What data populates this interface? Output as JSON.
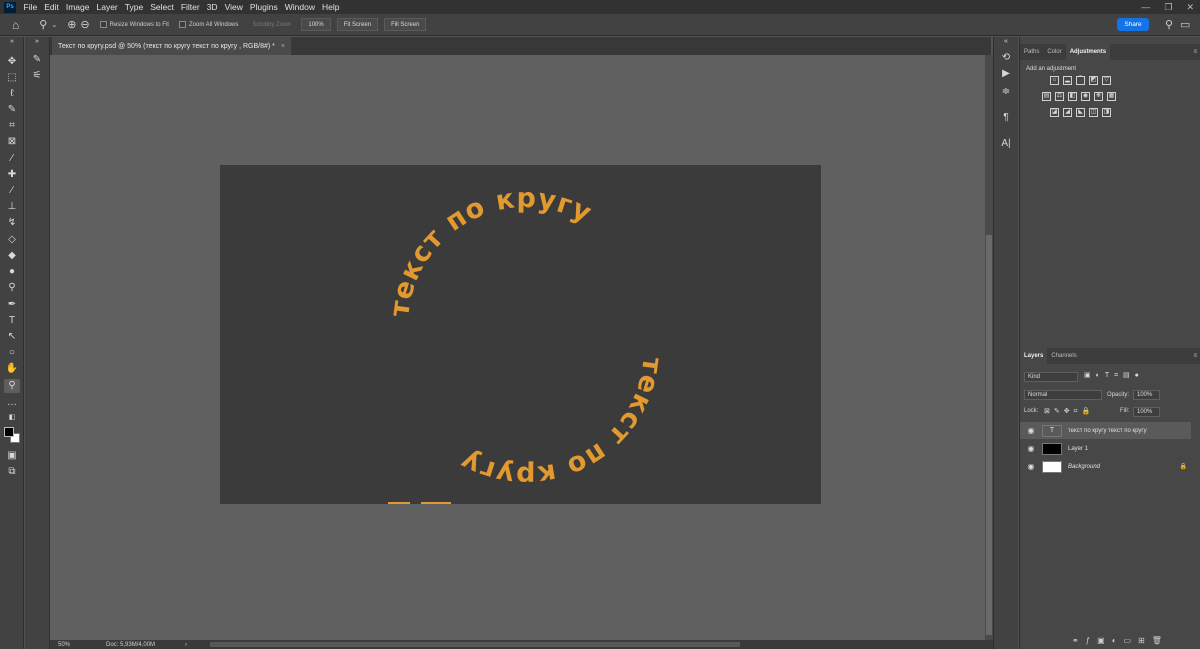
{
  "app": {
    "logo": "Ps"
  },
  "menu": [
    "File",
    "Edit",
    "Image",
    "Layer",
    "Type",
    "Select",
    "Filter",
    "3D",
    "View",
    "Plugins",
    "Window",
    "Help"
  ],
  "window_controls": [
    "—",
    "❐",
    "✕"
  ],
  "options_bar": {
    "resize_windows": "Resize Windows to Fit",
    "zoom_all": "Zoom All Windows",
    "scrubby": "Scrubby Zoom",
    "zoom_value": "100%",
    "fit_screen": "Fit Screen",
    "fill_screen": "Fill Screen",
    "share": "Share"
  },
  "document": {
    "tab_title": "Текст по кругу.psd @ 50% (текст по кругу  текст по кругу , RGB/8#) *",
    "top_arc": "текст по кругу",
    "bottom_arc": "текст по кругу",
    "text_color": "#e2992f"
  },
  "status": {
    "zoom": "50%",
    "doc": "Doc: 5,93M/4,00M"
  },
  "panels": {
    "top_tabs": [
      "Paths",
      "Color",
      "Adjustments"
    ],
    "adjust_hint": "Add an adjustment",
    "layer_tabs": [
      "Layers",
      "Channels"
    ],
    "kind": "Kind",
    "blend": "Normal",
    "opacity_label": "Opacity:",
    "opacity": "100%",
    "lock_label": "Lock:",
    "fill_label": "Fill:",
    "fill": "100%",
    "layers": [
      {
        "name": "текст по кругу  текст по кругу"
      },
      {
        "name": "Layer 1"
      },
      {
        "name": "Background"
      }
    ]
  }
}
